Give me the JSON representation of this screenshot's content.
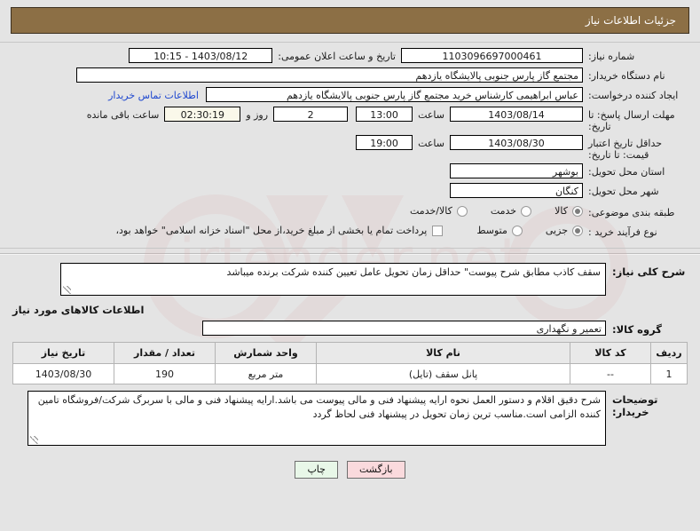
{
  "header": {
    "title": "جزئیات اطلاعات نیاز",
    "bar_color": "#8c6f45"
  },
  "form": {
    "need_number_label": "شماره نیاز:",
    "need_number_value": "1103096697000461",
    "public_announce_label": "تاریخ و ساعت اعلان عمومی:",
    "public_announce_value": "1403/08/12 - 10:15",
    "buyer_org_label": "نام دستگاه خریدار:",
    "buyer_org_value": "مجتمع گاز پارس جنوبی  پالایشگاه یازدهم",
    "creator_label": "ایجاد کننده درخواست:",
    "creator_value": "عباس ابراهیمی کارشناس خرید مجتمع گاز پارس جنوبی  پالایشگاه یازدهم",
    "contact_link": "اطلاعات تماس خریدار",
    "reply_deadline_label": "مهلت ارسال پاسخ: تا تاریخ:",
    "reply_deadline_date": "1403/08/14",
    "hour_label": "ساعت",
    "reply_deadline_time": "13:00",
    "days_value": "2",
    "days_and_label": "روز و",
    "countdown_value": "02:30:19",
    "countdown_suffix": "ساعت باقی مانده",
    "price_validity_label": "حداقل تاریخ اعتبار قیمت: تا تاریخ:",
    "price_validity_date": "1403/08/30",
    "price_validity_time": "19:00",
    "province_label": "استان محل تحویل:",
    "province_value": "بوشهر",
    "city_label": "شهر محل تحویل:",
    "city_value": "کنگان",
    "subject_class_label": "طبقه بندی موضوعی:",
    "subject_options": [
      {
        "label": "کالا",
        "selected": true
      },
      {
        "label": "خدمت",
        "selected": false
      },
      {
        "label": "کالا/خدمت",
        "selected": false
      }
    ],
    "process_type_label": "نوع فرآیند خرید :",
    "process_options": [
      {
        "label": "جزیی",
        "selected": true
      },
      {
        "label": "متوسط",
        "selected": false
      }
    ],
    "treasury_checkbox_label": "پرداخت تمام یا بخشی از مبلغ خرید،از محل \"اسناد خزانه اسلامی\" خواهد بود،",
    "treasury_checked": false
  },
  "need_summary": {
    "label": "شرح کلی نیاز:",
    "value": "سقف کاذب مطابق شرح پیوست\" حداقل زمان تحویل عامل تعیین کننده شرکت برنده میباشد"
  },
  "goods_section": {
    "title": "اطلاعات کالاهای مورد نیاز",
    "group_label": "گروه کالا:",
    "group_value": "تعمیر و نگهداری"
  },
  "items_table": {
    "headers": [
      "ردیف",
      "کد کالا",
      "نام کالا",
      "واحد شمارش",
      "تعداد / مقدار",
      "تاریخ نیاز"
    ],
    "rows": [
      {
        "radif": "1",
        "code": "--",
        "name": "پانل سقف (تایل)",
        "unit": "متر مربع",
        "qty": "190",
        "need_date": "1403/08/30"
      }
    ]
  },
  "buyer_notes": {
    "label": "توضیحات خریدار:",
    "value": "شرح دقیق اقلام و دستور العمل نحوه ارایه پیشنهاد فنی و مالی پیوست می باشد.ارایه پیشنهاد فنی و مالی با سربرگ شرکت/فروشگاه تامین کننده الزامی است.مناسب ترین زمان تحویل در پیشنهاد فنی لحاظ گردد"
  },
  "buttons": {
    "print": "چاپ",
    "back": "بازگشت"
  },
  "watermark": {
    "text": "irtender.net"
  }
}
